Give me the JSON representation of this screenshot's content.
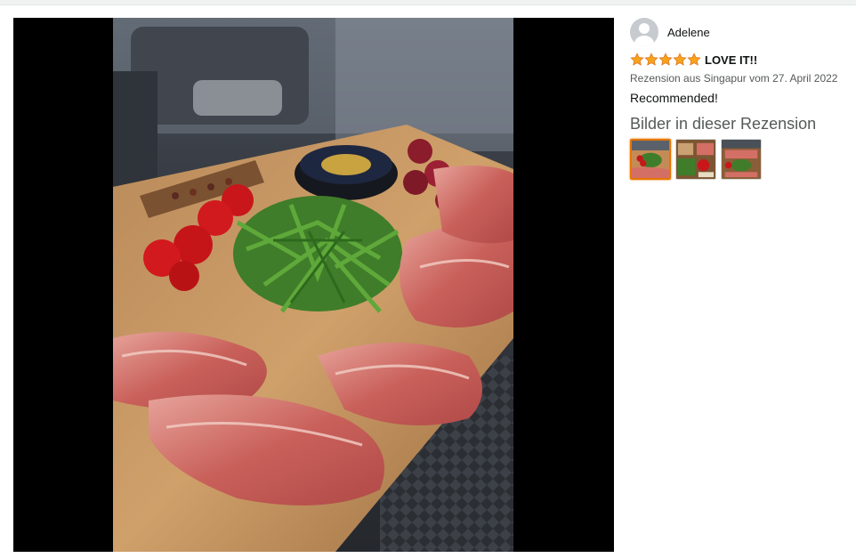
{
  "profile": {
    "name": "Adelene",
    "avatar_icon": "default-avatar-icon"
  },
  "review": {
    "rating": 5,
    "rating_max": 5,
    "title": "LOVE IT!!",
    "date_line": "Rezension aus Singapur vom 27. April 2022",
    "body": "Recommended!"
  },
  "images_section": {
    "heading": "Bilder in dieser Rezension",
    "thumbnails": [
      {
        "selected": true
      },
      {
        "selected": false
      },
      {
        "selected": false
      }
    ]
  },
  "colors": {
    "star": "#f7a31c",
    "star_outline": "#de7921",
    "selected_border": "#e77600"
  }
}
